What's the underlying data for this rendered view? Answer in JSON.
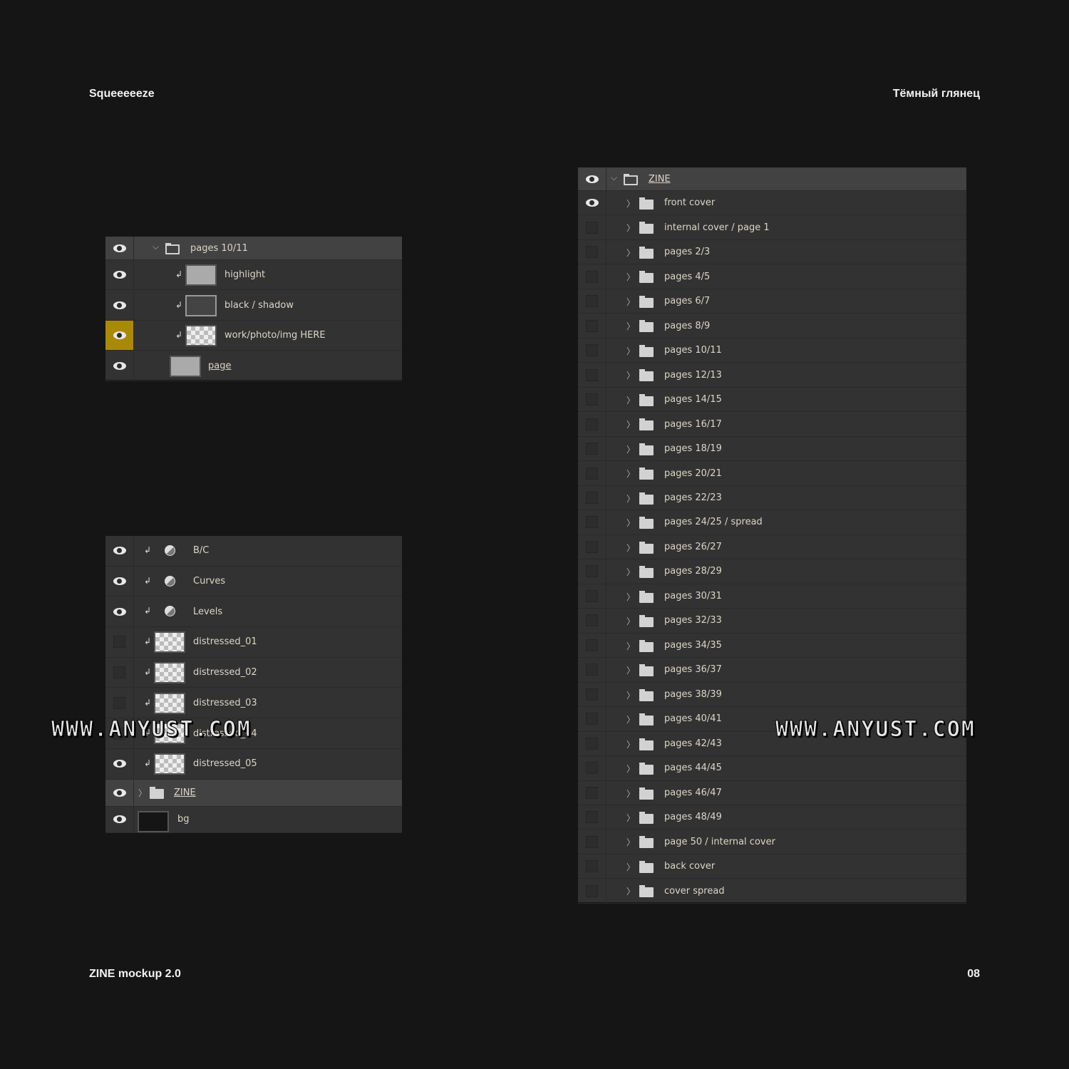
{
  "corners": {
    "top_left": "Squeeeeeze",
    "top_right": "Тёмный глянец",
    "bottom_left": "ZINE mockup 2.0",
    "bottom_right": "08"
  },
  "accent_color": "#a98a07",
  "panel_group": {
    "header": "pages 10/11",
    "layers": [
      {
        "name": "highlight",
        "visible": true,
        "thumb": "gray",
        "clip": true
      },
      {
        "name": "black / shadow",
        "visible": true,
        "thumb": "dark",
        "clip": true
      },
      {
        "name": "work/photo/img HERE",
        "visible": true,
        "thumb": "check",
        "clip": true,
        "highlighted": true
      },
      {
        "name": "page",
        "visible": true,
        "thumb": "gray",
        "clip": false,
        "underline": true
      }
    ]
  },
  "panel_stack": {
    "layers": [
      {
        "name": "B/C",
        "visible": true,
        "type": "adjustment"
      },
      {
        "name": "Curves",
        "visible": true,
        "type": "adjustment"
      },
      {
        "name": "Levels",
        "visible": true,
        "type": "adjustment"
      },
      {
        "name": "distressed_01",
        "visible": false,
        "type": "check"
      },
      {
        "name": "distressed_02",
        "visible": false,
        "type": "check"
      },
      {
        "name": "distressed_03",
        "visible": false,
        "type": "check"
      },
      {
        "name": "distressed_04",
        "visible": false,
        "type": "check"
      },
      {
        "name": "distressed_05",
        "visible": true,
        "type": "check"
      },
      {
        "name": "ZINE",
        "visible": true,
        "type": "folder"
      },
      {
        "name": "bg",
        "visible": true,
        "type": "bg"
      }
    ]
  },
  "panel_zine": {
    "header": "ZINE",
    "folders": [
      {
        "name": "front cover",
        "visible": true
      },
      {
        "name": "internal cover / page 1"
      },
      {
        "name": "pages 2/3"
      },
      {
        "name": "pages 4/5"
      },
      {
        "name": "pages 6/7"
      },
      {
        "name": "pages 8/9"
      },
      {
        "name": "pages 10/11"
      },
      {
        "name": "pages 12/13"
      },
      {
        "name": "pages 14/15"
      },
      {
        "name": "pages 16/17"
      },
      {
        "name": "pages 18/19"
      },
      {
        "name": "pages 20/21"
      },
      {
        "name": "pages 22/23"
      },
      {
        "name": "pages 24/25 / spread"
      },
      {
        "name": "pages 26/27"
      },
      {
        "name": "pages 28/29"
      },
      {
        "name": "pages 30/31"
      },
      {
        "name": "pages 32/33"
      },
      {
        "name": "pages 34/35"
      },
      {
        "name": "pages 36/37"
      },
      {
        "name": "pages 38/39"
      },
      {
        "name": "pages 40/41"
      },
      {
        "name": "pages 42/43"
      },
      {
        "name": "pages 44/45"
      },
      {
        "name": "pages 46/47"
      },
      {
        "name": "pages 48/49"
      },
      {
        "name": "page 50 / internal cover"
      },
      {
        "name": "back cover"
      },
      {
        "name": "cover spread"
      }
    ]
  },
  "watermark": "WWW.ANYUST.COM"
}
